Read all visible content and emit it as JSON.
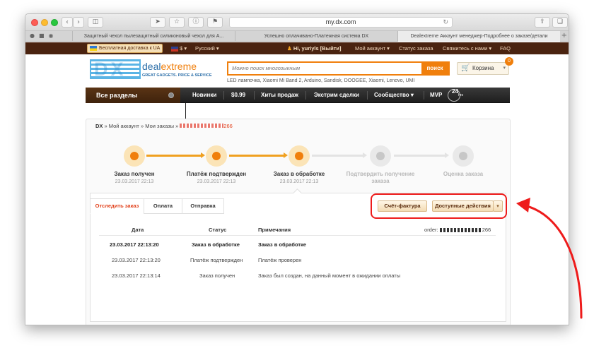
{
  "browser": {
    "url": "my.dx.com",
    "tabs": [
      {
        "title": "Защитный чехол пылезащитный силиконовый чехол для A..."
      },
      {
        "title": "Успешно оплачивано-Платежная система DX"
      },
      {
        "title": "Dealextreme Аккаунт менеджер-Подробнее о заказе/детали"
      }
    ],
    "tab_plus": "+"
  },
  "topbar": {
    "free_shipping": "Бесплатная доставка к UA",
    "currency": "$",
    "language": "Русский",
    "greeting": "Hi, yuriyls [Выйти]",
    "my_account": "Мой аккаунт",
    "order_status": "Статус заказа",
    "contact": "Свяжитесь с нами",
    "faq": "FAQ"
  },
  "header": {
    "logo_main": "DX",
    "logo_deal": "deal",
    "logo_extreme": "extreme",
    "logo_tagline": "GREAT GADGETS. PRICE & SERVICE",
    "search_placeholder": "Можно поиск многозыкным",
    "search_button": "поиск",
    "cart_label": "Корзина",
    "cart_count": "0",
    "hot_words": "LED лампочка,  Xiaomi Mi Band 2,  Arduino,  Sandisk,  DOOGEE,  Xiaomi,  Lenovo,  UMI"
  },
  "nav": {
    "all_sections": "Все разделы",
    "items": [
      {
        "label": "Новинки"
      },
      {
        "label": "$0.99"
      },
      {
        "label": "Хиты продаж"
      },
      {
        "label": "Экстрим сделки"
      },
      {
        "label": "Сообщество"
      },
      {
        "label": "MVP"
      }
    ],
    "badge_24": "24",
    "badge_hrs": "hrs"
  },
  "breadcrumb": {
    "root": "DX",
    "account": "Мой аккаунт",
    "orders": "Мои заказы",
    "order_id": "266"
  },
  "progress": {
    "steps": [
      {
        "label": "Заказ получен",
        "date": "23.03.2017 22:13",
        "state": "done"
      },
      {
        "label": "Платёж подтвержден",
        "date": "23.03.2017 22:13",
        "state": "done"
      },
      {
        "label": "Заказ в обработке",
        "date": "23.03.2017 22:13",
        "state": "done"
      },
      {
        "label": "Подтвердить получение заказа",
        "date": "",
        "state": "todo"
      },
      {
        "label": "Оценка заказа",
        "date": "",
        "state": "todo"
      }
    ],
    "colors": {
      "done": "#f07f0c",
      "todo": "#c7c7c7",
      "connector_done": "#f0a020"
    }
  },
  "order_tabs": [
    {
      "label": "Отследить заказ",
      "active": true
    },
    {
      "label": "Оплата",
      "active": false
    },
    {
      "label": "Отправка",
      "active": false
    }
  ],
  "actions": {
    "invoice": "Счёт-фактура",
    "available": "Доступные действия",
    "dropdown_icon": "chevron-down-icon"
  },
  "table": {
    "headers": {
      "date": "Дата",
      "status": "Статус",
      "notes": "Примечания"
    },
    "order_label": "order:",
    "order_suffix": "266",
    "rows": [
      {
        "date": "23.03.2017 22:13:20",
        "status": "Заказ в обработке",
        "note": "Заказ в обработке",
        "bold": true
      },
      {
        "date": "23.03.2017 22:13:20",
        "status": "Платёж подтвержден",
        "note": "Платёж проверен",
        "bold": false
      },
      {
        "date": "23.03.2017 22:13:14",
        "status": "Заказ получен",
        "note": "Заказ был создан, на данный момент в ожидании оплаты",
        "bold": false
      }
    ]
  },
  "annotation": {
    "highlight_color": "#ee1b1b"
  }
}
